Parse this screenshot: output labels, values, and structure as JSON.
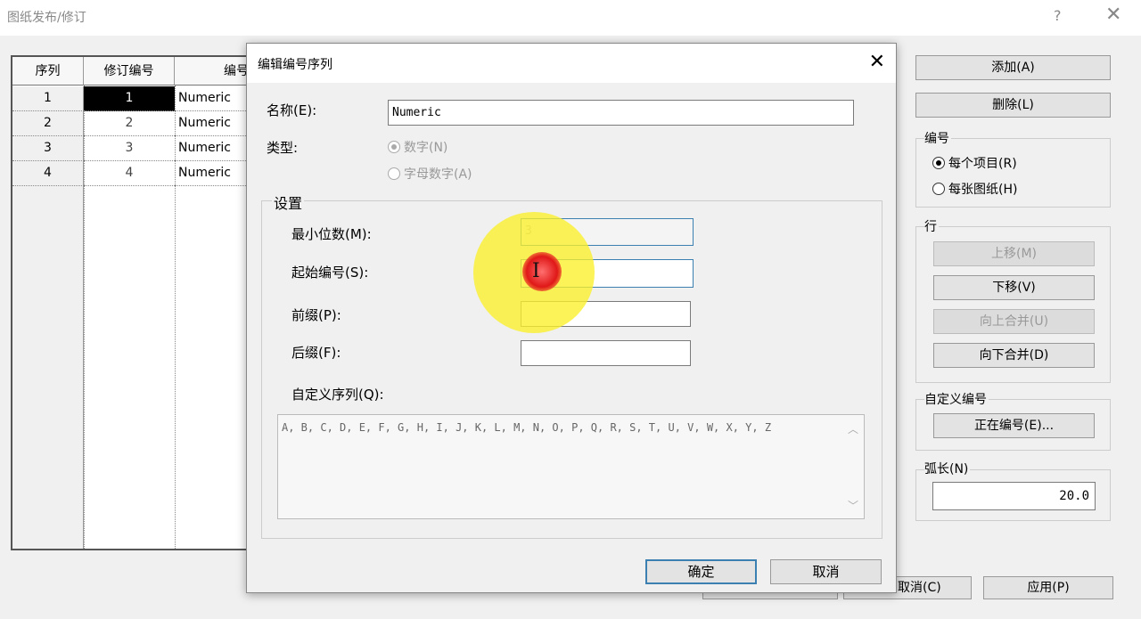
{
  "window": {
    "title": "图纸发布/修订",
    "help": "?",
    "close": "✕"
  },
  "table": {
    "headers": [
      "序列",
      "修订编号",
      "编号"
    ],
    "rows": [
      {
        "seq": "1",
        "rev": "1",
        "num": "Numeric"
      },
      {
        "seq": "2",
        "rev": "2",
        "num": "Numeric"
      },
      {
        "seq": "3",
        "rev": "3",
        "num": "Numeric"
      },
      {
        "seq": "4",
        "rev": "4",
        "num": "Numeric"
      }
    ]
  },
  "right_panel": {
    "add": "添加(A)",
    "delete": "删除(L)",
    "numbering": {
      "label": "编号",
      "per_project": "每个项目(R)",
      "per_sheet": "每张图纸(H)"
    },
    "row": {
      "label": "行",
      "move_up": "上移(M)",
      "move_down": "下移(V)",
      "merge_up": "向上合并(U)",
      "merge_down": "向下合并(D)"
    },
    "custom": {
      "label": "自定义编号",
      "button": "正在编号(E)..."
    },
    "arc": {
      "label": "弧长(N)",
      "value": "20.0"
    }
  },
  "bottom": {
    "cancel": "取消(C)",
    "apply": "应用(P)"
  },
  "dialog": {
    "title": "编辑编号序列",
    "close": "✕",
    "name_label": "名称(E):",
    "name_value": "Numeric",
    "type_label": "类型:",
    "type_numeric": "数字(N)",
    "type_alpha": "字母数字(A)",
    "settings_label": "设置",
    "min_digits_label": "最小位数(M):",
    "min_digits_value": "3",
    "start_label": "起始编号(S):",
    "start_value": "",
    "prefix_label": "前缀(P):",
    "suffix_label": "后缀(F):",
    "custom_seq_label": "自定义序列(Q):",
    "custom_seq_value": "A, B, C, D, E, F, G, H, I, J, K, L, M, N, O, P, Q, R, S, T, U, V, W, X, Y, Z",
    "ok": "确定",
    "cancel": "取消"
  }
}
